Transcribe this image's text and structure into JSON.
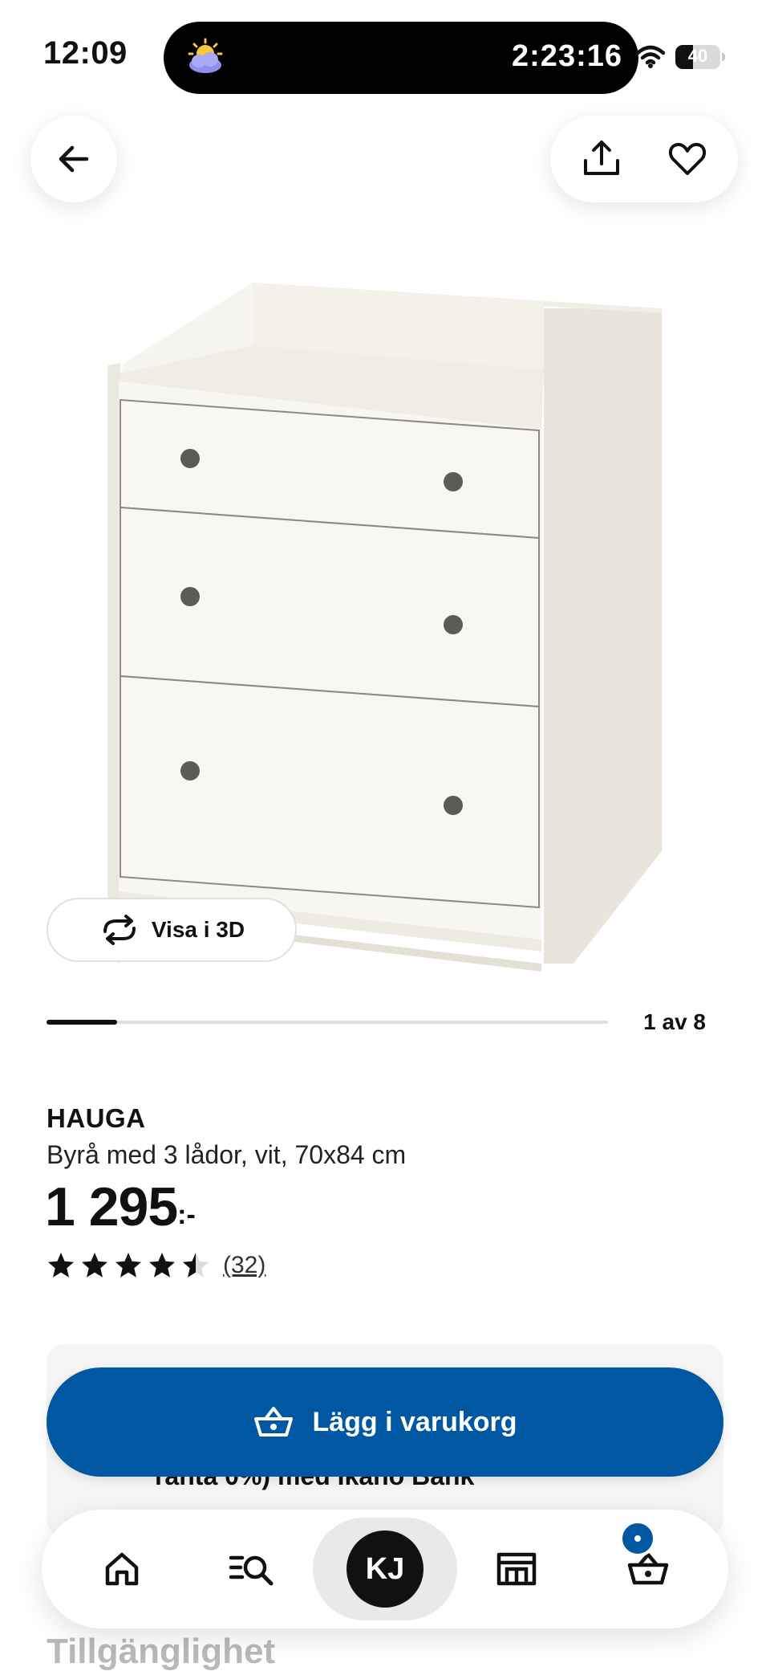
{
  "status_bar": {
    "time": "12:09",
    "timer": "2:23:16",
    "battery_level": "40",
    "battery_fraction": 0.4,
    "icons": [
      "weather-icon",
      "wifi-icon",
      "battery-icon"
    ]
  },
  "top_nav": {
    "icons": [
      "back-arrow-icon",
      "share-icon",
      "heart-icon"
    ]
  },
  "gallery": {
    "view_3d_label": "Visa i 3D",
    "counter": "1 av 8",
    "current": 1,
    "total": 8
  },
  "product": {
    "name": "HAUGA",
    "description": "Byrå med 3 lådor, vit, 70x84 cm",
    "price": "1 295",
    "price_suffix": ":-",
    "rating": 4.5,
    "rating_max": 5,
    "review_count": "(32)"
  },
  "finance": {
    "text": "ränta 0%) med Ikano Bank"
  },
  "cart": {
    "add_label": "Lägg i varukorg"
  },
  "sections": {
    "availability": "Tillgänglighet"
  },
  "tab_bar": {
    "profile_initials": "KJ",
    "items": [
      "home-icon",
      "search-list-icon",
      "profile-avatar",
      "store-icon",
      "cart-icon"
    ]
  },
  "colors": {
    "brand_blue": "#0058a3",
    "text": "#111111",
    "panel_grey": "#f5f5f5"
  }
}
